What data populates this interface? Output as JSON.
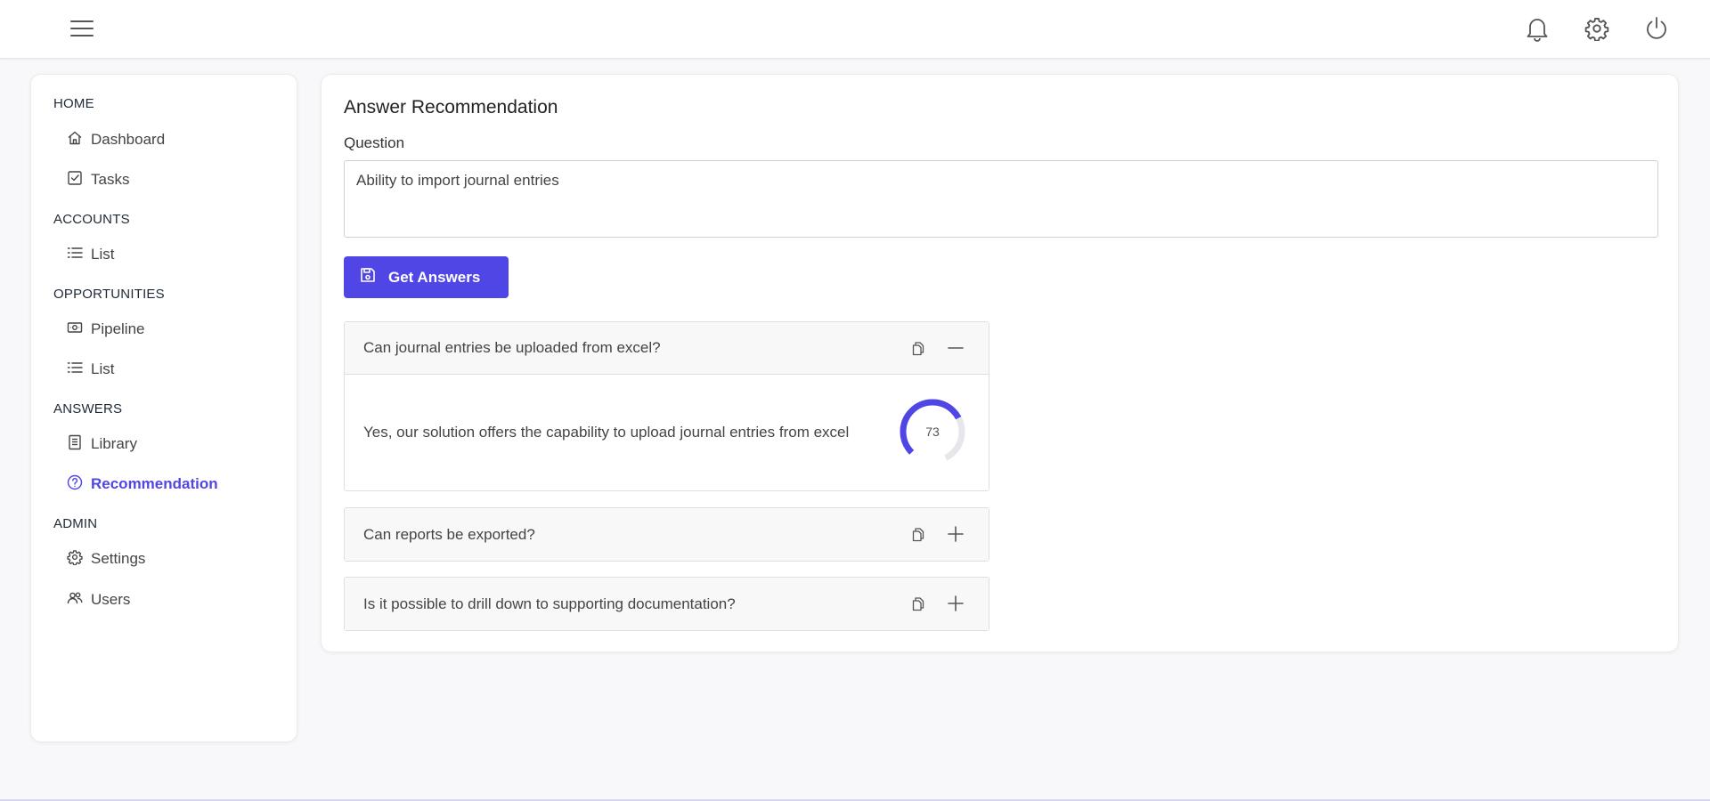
{
  "sidebar": {
    "sections": [
      {
        "title": "HOME",
        "items": [
          {
            "label": "Dashboard",
            "icon": "home-icon"
          },
          {
            "label": "Tasks",
            "icon": "checkbox-icon"
          }
        ]
      },
      {
        "title": "ACCOUNTS",
        "items": [
          {
            "label": "List",
            "icon": "list-icon"
          }
        ]
      },
      {
        "title": "OPPORTUNITIES",
        "items": [
          {
            "label": "Pipeline",
            "icon": "money-icon"
          },
          {
            "label": "List",
            "icon": "list-icon"
          }
        ]
      },
      {
        "title": "ANSWERS",
        "items": [
          {
            "label": "Library",
            "icon": "book-icon"
          },
          {
            "label": "Recommendation",
            "icon": "question-circle-icon",
            "active": true
          }
        ]
      },
      {
        "title": "ADMIN",
        "items": [
          {
            "label": "Settings",
            "icon": "gear-icon"
          },
          {
            "label": "Users",
            "icon": "users-icon"
          }
        ]
      }
    ]
  },
  "main": {
    "title": "Answer Recommendation",
    "question_label": "Question",
    "question_value": "Ability to import journal entries",
    "get_answers_label": "Get Answers",
    "answers": [
      {
        "question": "Can journal entries be uploaded from excel?",
        "expanded": true,
        "answer": "Yes, our solution offers the capability to upload journal entries from excel",
        "score": 73
      },
      {
        "question": "Can reports be exported?",
        "expanded": false
      },
      {
        "question": "Is it possible to drill down to supporting documentation?",
        "expanded": false
      }
    ]
  },
  "colors": {
    "accent": "#4f46e5",
    "gauge_track": "#e5e7eb"
  }
}
